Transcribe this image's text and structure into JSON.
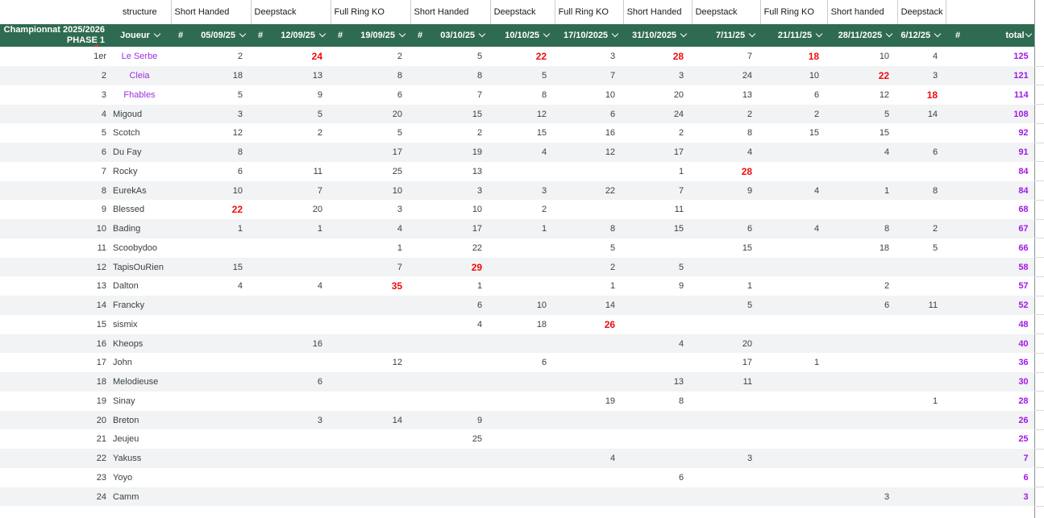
{
  "title": {
    "line1": "Championnat 2025/2026",
    "line2": "PHASE 1"
  },
  "structure": {
    "labels": [
      "structure",
      "Short Handed",
      "Deepstack",
      "Full Ring KO",
      "Short Handed",
      "Deepstack",
      "Full Ring KO",
      "Short Handed",
      "Deepstack",
      "Full Ring KO",
      "Short handed",
      "Deepstack"
    ]
  },
  "header": {
    "joueur": "Joueur",
    "hash": "#",
    "total": "total",
    "dates": [
      "05/09/25",
      "12/09/25",
      "19/09/25",
      "03/10/25",
      "10/10/25",
      "17/10/2025",
      "31/10/2025",
      "7/11/25",
      "21/11/25",
      "28/11/2025",
      "6/12/25"
    ]
  },
  "colors": {
    "header_green": "#2F6B51",
    "stripe_grey": "#f1f3f4",
    "value_red": "#ee0c0c",
    "total_purple": "#a119e6",
    "name_purple": "#9c2fe2"
  },
  "players": [
    {
      "rank": "1er",
      "name": "Le Serbe",
      "hl": true,
      "v": [
        2,
        24,
        2,
        5,
        22,
        3,
        28,
        7,
        18,
        10,
        4
      ],
      "red": [
        1,
        4,
        6,
        8
      ],
      "total": 125
    },
    {
      "rank": "2",
      "name": "Cleia",
      "hl": true,
      "v": [
        18,
        13,
        8,
        8,
        5,
        7,
        3,
        24,
        10,
        22,
        3
      ],
      "red": [
        9
      ],
      "total": 121
    },
    {
      "rank": "3",
      "name": "Fhables",
      "hl": true,
      "v": [
        5,
        9,
        6,
        7,
        8,
        10,
        20,
        13,
        6,
        12,
        18
      ],
      "red": [
        10
      ],
      "total": 114
    },
    {
      "rank": "4",
      "name": "Migoud",
      "hl": false,
      "v": [
        3,
        5,
        20,
        15,
        12,
        6,
        24,
        2,
        2,
        5,
        14
      ],
      "red": [],
      "total": 108
    },
    {
      "rank": "5",
      "name": "Scotch",
      "hl": false,
      "v": [
        12,
        2,
        5,
        2,
        15,
        16,
        2,
        8,
        15,
        15,
        null
      ],
      "red": [],
      "total": 92
    },
    {
      "rank": "6",
      "name": "Du Fay",
      "hl": false,
      "v": [
        8,
        null,
        17,
        19,
        4,
        12,
        17,
        4,
        null,
        4,
        6
      ],
      "red": [],
      "total": 91
    },
    {
      "rank": "7",
      "name": "Rocky",
      "hl": false,
      "v": [
        6,
        11,
        25,
        13,
        null,
        null,
        1,
        28,
        null,
        null,
        null
      ],
      "red": [
        7
      ],
      "total": 84
    },
    {
      "rank": "8",
      "name": "EurekAs",
      "hl": false,
      "v": [
        10,
        7,
        10,
        3,
        3,
        22,
        7,
        9,
        4,
        1,
        8
      ],
      "red": [],
      "total": 84
    },
    {
      "rank": "9",
      "name": "Blessed",
      "hl": false,
      "v": [
        22,
        20,
        3,
        10,
        2,
        null,
        11,
        null,
        null,
        null,
        null
      ],
      "red": [
        0
      ],
      "total": 68
    },
    {
      "rank": "10",
      "name": "Bading",
      "hl": false,
      "v": [
        1,
        1,
        4,
        17,
        1,
        8,
        15,
        6,
        4,
        8,
        2
      ],
      "red": [],
      "total": 67
    },
    {
      "rank": "11",
      "name": "Scoobydoo",
      "hl": false,
      "v": [
        null,
        null,
        1,
        22,
        null,
        5,
        null,
        15,
        null,
        18,
        5
      ],
      "red": [],
      "total": 66
    },
    {
      "rank": "12",
      "name": "TapisOuRien",
      "hl": false,
      "v": [
        15,
        null,
        7,
        29,
        null,
        2,
        5,
        null,
        null,
        null,
        null
      ],
      "red": [
        3
      ],
      "total": 58
    },
    {
      "rank": "13",
      "name": "Dalton",
      "hl": false,
      "v": [
        4,
        4,
        35,
        1,
        null,
        1,
        9,
        1,
        null,
        2,
        null
      ],
      "red": [
        2
      ],
      "total": 57
    },
    {
      "rank": "14",
      "name": "Francky",
      "hl": false,
      "v": [
        null,
        null,
        null,
        6,
        10,
        14,
        null,
        5,
        null,
        6,
        11
      ],
      "red": [],
      "total": 52
    },
    {
      "rank": "15",
      "name": "sismix",
      "hl": false,
      "v": [
        null,
        null,
        null,
        4,
        18,
        26,
        null,
        null,
        null,
        null,
        null
      ],
      "red": [
        5
      ],
      "total": 48
    },
    {
      "rank": "16",
      "name": "Kheops",
      "hl": false,
      "v": [
        null,
        16,
        null,
        null,
        null,
        null,
        4,
        20,
        null,
        null,
        null
      ],
      "red": [],
      "total": 40
    },
    {
      "rank": "17",
      "name": "John",
      "hl": false,
      "v": [
        null,
        null,
        12,
        null,
        6,
        null,
        null,
        17,
        1,
        null,
        null
      ],
      "red": [],
      "total": 36
    },
    {
      "rank": "18",
      "name": "Melodieuse",
      "hl": false,
      "v": [
        null,
        6,
        null,
        null,
        null,
        null,
        13,
        11,
        null,
        null,
        null
      ],
      "red": [],
      "total": 30
    },
    {
      "rank": "19",
      "name": "Sinay",
      "hl": false,
      "v": [
        null,
        null,
        null,
        null,
        null,
        19,
        8,
        null,
        null,
        null,
        1
      ],
      "red": [],
      "total": 28
    },
    {
      "rank": "20",
      "name": "Breton",
      "hl": false,
      "v": [
        null,
        3,
        14,
        9,
        null,
        null,
        null,
        null,
        null,
        null,
        null
      ],
      "red": [],
      "total": 26
    },
    {
      "rank": "21",
      "name": "Jeujeu",
      "hl": false,
      "v": [
        null,
        null,
        null,
        25,
        null,
        null,
        null,
        null,
        null,
        null,
        null
      ],
      "red": [],
      "total": 25
    },
    {
      "rank": "22",
      "name": "Yakuss",
      "hl": false,
      "v": [
        null,
        null,
        null,
        null,
        null,
        4,
        null,
        3,
        null,
        null,
        null
      ],
      "red": [],
      "total": 7
    },
    {
      "rank": "23",
      "name": "Yoyo",
      "hl": false,
      "v": [
        null,
        null,
        null,
        null,
        null,
        null,
        6,
        null,
        null,
        null,
        null
      ],
      "red": [],
      "total": 6
    },
    {
      "rank": "24",
      "name": "Camm",
      "hl": false,
      "v": [
        null,
        null,
        null,
        null,
        null,
        null,
        null,
        null,
        null,
        3,
        null
      ],
      "red": [],
      "total": 3
    }
  ]
}
